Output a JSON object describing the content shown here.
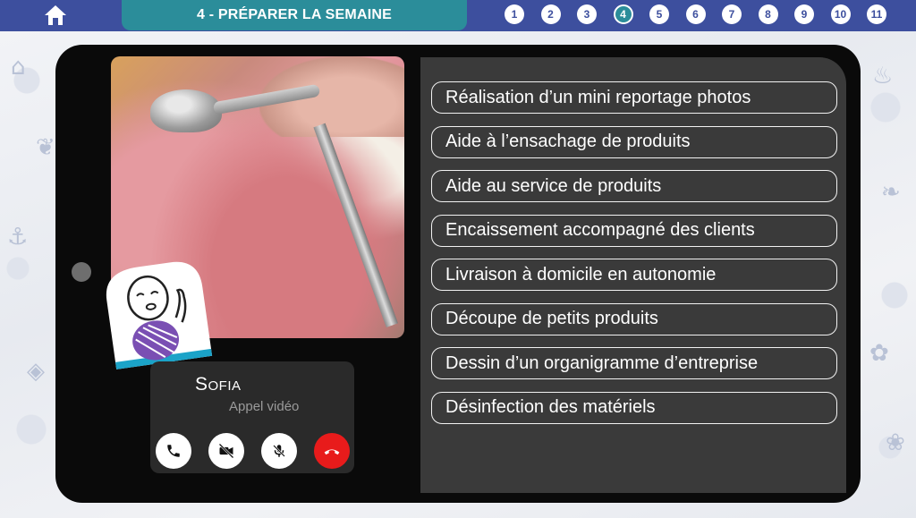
{
  "header": {
    "title": "4 - PRÉPARER LA SEMAINE",
    "steps": [
      {
        "label": "1"
      },
      {
        "label": "2"
      },
      {
        "label": "3"
      },
      {
        "label": "4",
        "active": true
      },
      {
        "label": "5"
      },
      {
        "label": "6"
      },
      {
        "label": "7"
      },
      {
        "label": "8"
      },
      {
        "label": "9"
      },
      {
        "label": "10"
      },
      {
        "label": "11"
      }
    ]
  },
  "call": {
    "name": "Sofia",
    "status": "Appel vidéo",
    "buttons": [
      "phone-icon",
      "video-off-icon",
      "mic-off-icon",
      "hang-up-icon"
    ]
  },
  "activities": [
    "Réalisation d’un mini reportage photos",
    "Aide à l’ensachage de produits",
    "Aide au service de produits",
    "Encaissement accompagné des clients",
    "Livraison à domicile en autonomie",
    "Découpe de petits produits",
    "Dessin d’un organigramme d’entreprise",
    "Désinfection des matériels"
  ],
  "colors": {
    "nav_bar": "#3d4f9e",
    "accent": "#2b8d9a",
    "tablet": "#0a0a0a",
    "panel": "#3a3a3a",
    "end_call": "#e81b1b"
  }
}
